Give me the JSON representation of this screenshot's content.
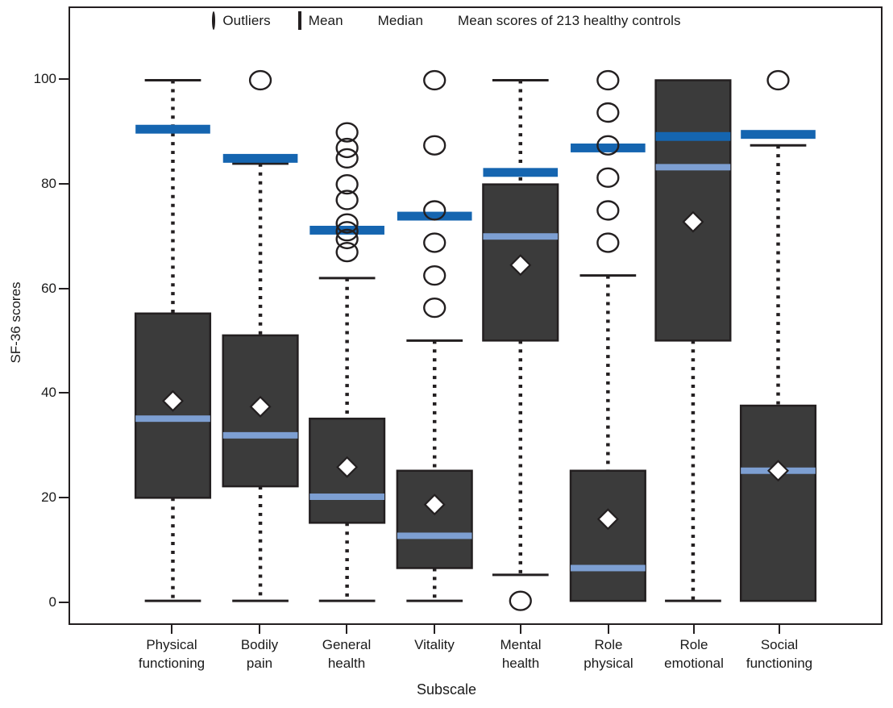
{
  "chart_data": {
    "type": "box",
    "title": "",
    "xlabel": "Subscale",
    "ylabel": "SF-36 scores",
    "ylim": [
      -8,
      112
    ],
    "yticks": [
      0,
      20,
      40,
      60,
      80,
      100
    ],
    "grid": false,
    "legend_position": "top-center",
    "legend": [
      {
        "key": "outliers",
        "label": "Outliers",
        "glyph": "circle-outline-icon"
      },
      {
        "key": "mean",
        "label": "Mean",
        "glyph": "diamond-outline-icon"
      },
      {
        "key": "median",
        "label": "Median",
        "glyph": "light-blue-bar-icon",
        "color": "#7d9fd2"
      },
      {
        "key": "control_mean",
        "label": "Mean scores of  213 healthy controls",
        "glyph": "dark-blue-bar-icon",
        "color": "#1565b0"
      }
    ],
    "colors": {
      "box_fill": "#3b3b3b",
      "box_edge": "#231f20",
      "median": "#7d9fd2",
      "control_mean": "#1565b0",
      "whisker": "#231f20",
      "mean_marker_fill": "#ffffff",
      "axis": "#231f20"
    },
    "categories": [
      "Physical\nfunctioning",
      "Bodily\npain",
      "General\nhealth",
      "Vitality",
      "Mental\nhealth",
      "Role\nphysical",
      "Role\nemotional",
      "Social\nfunctioning"
    ],
    "boxes": [
      {
        "category": "Physical functioning",
        "whisker_low": 0,
        "q1": 19.8,
        "median": 35.0,
        "mean": 38.4,
        "q3": 55.2,
        "whisker_high": 100,
        "control_mean": 90.6,
        "outliers": []
      },
      {
        "category": "Bodily pain",
        "whisker_low": 0,
        "q1": 22.0,
        "median": 31.8,
        "mean": 37.3,
        "q3": 51.0,
        "whisker_high": 84.0,
        "control_mean": 85.0,
        "outliers": [
          100
        ]
      },
      {
        "category": "General health",
        "whisker_low": 0,
        "q1": 15.0,
        "median": 20.0,
        "mean": 25.7,
        "q3": 35.0,
        "whisker_high": 62.0,
        "control_mean": 71.2,
        "outliers": [
          90,
          87,
          85,
          80,
          77,
          72.5,
          71,
          69.5,
          67
        ]
      },
      {
        "category": "Vitality",
        "whisker_low": 0,
        "q1": 6.3,
        "median": 12.5,
        "mean": 18.5,
        "q3": 25.0,
        "whisker_high": 50.0,
        "control_mean": 73.9,
        "outliers": [
          100,
          87.5,
          75,
          68.8,
          62.5,
          56.3
        ]
      },
      {
        "category": "Mental health",
        "whisker_low": 5.0,
        "q1": 50.0,
        "median": 70.0,
        "mean": 64.5,
        "q3": 80.0,
        "whisker_high": 100,
        "control_mean": 82.3,
        "outliers": [
          0
        ]
      },
      {
        "category": "Role physical",
        "whisker_low": 0,
        "q1": 0,
        "median": 6.3,
        "mean": 15.7,
        "q3": 25.0,
        "whisker_high": 62.5,
        "control_mean": 87.0,
        "outliers": [
          100,
          93.8,
          87.5,
          81.3,
          75,
          68.8
        ]
      },
      {
        "category": "Role emotional",
        "whisker_low": 0,
        "q1": 50.0,
        "median": 83.3,
        "mean": 72.8,
        "q3": 100,
        "whisker_high": 100,
        "control_mean": 89.2,
        "outliers": []
      },
      {
        "category": "Social functioning",
        "whisker_low": 0,
        "q1": 0,
        "median": 25.0,
        "mean": 25.0,
        "q3": 37.5,
        "whisker_high": 87.5,
        "control_mean": 89.6,
        "outliers": [
          100
        ]
      }
    ]
  }
}
